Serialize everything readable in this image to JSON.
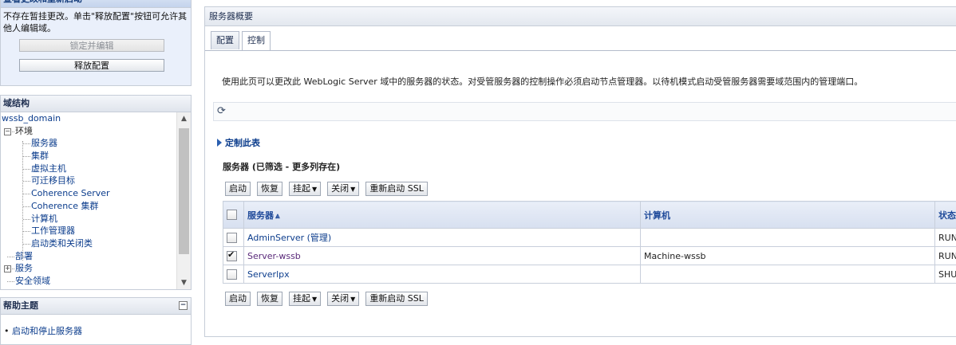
{
  "change_center": {
    "title": "查看更改和重新启动",
    "message": "不存在暂挂更改。单击\"释放配置\"按钮可允许其他人编辑域。",
    "lock_button": "锁定并编辑",
    "release_button": "释放配置"
  },
  "domain_structure": {
    "title": "域结构",
    "items": [
      {
        "label": "wssb_domain",
        "level": 0
      },
      {
        "label": "环境",
        "level": 0
      },
      {
        "label": "服务器",
        "level": 2
      },
      {
        "label": "集群",
        "level": 2
      },
      {
        "label": "虚拟主机",
        "level": 2
      },
      {
        "label": "可迁移目标",
        "level": 2
      },
      {
        "label": "Coherence Server",
        "level": 2
      },
      {
        "label": "Coherence 集群",
        "level": 2
      },
      {
        "label": "计算机",
        "level": 2
      },
      {
        "label": "工作管理器",
        "level": 2
      },
      {
        "label": "启动类和关闭类",
        "level": 2
      },
      {
        "label": "部署",
        "level": 1
      },
      {
        "label": "服务",
        "level": 0
      },
      {
        "label": "安全领域",
        "level": 1
      }
    ]
  },
  "help": {
    "title": "帮助主题",
    "items": [
      "启动和停止服务器"
    ]
  },
  "main": {
    "title": "服务器概要",
    "tabs": [
      "配置",
      "控制"
    ],
    "active_tab": "控制",
    "intro": "使用此页可以更改此 WebLogic Server 域中的服务器的状态。对受管服务器的控制操作必须启动节点管理器。以待机模式启动受管服务器需要域范围内的管理端口。",
    "customize_link": "定制此表",
    "table_title": "服务器 (已筛选 - 更多列存在)",
    "toolbar": {
      "start": "启动",
      "resume": "恢复",
      "suspend": "挂起",
      "shutdown": "关闭",
      "restart_ssl": "重新启动 SSL"
    },
    "columns": [
      "服务器",
      "计算机",
      "状态"
    ],
    "rows": [
      {
        "server": "AdminServer (管理)",
        "machine": "",
        "state": "RUNI",
        "checked": false
      },
      {
        "server": "Server-wssb",
        "machine": "Machine-wssb",
        "state": "RUNI",
        "checked": true
      },
      {
        "server": "Serverlpx",
        "machine": "",
        "state": "SHUT",
        "checked": false
      }
    ]
  }
}
